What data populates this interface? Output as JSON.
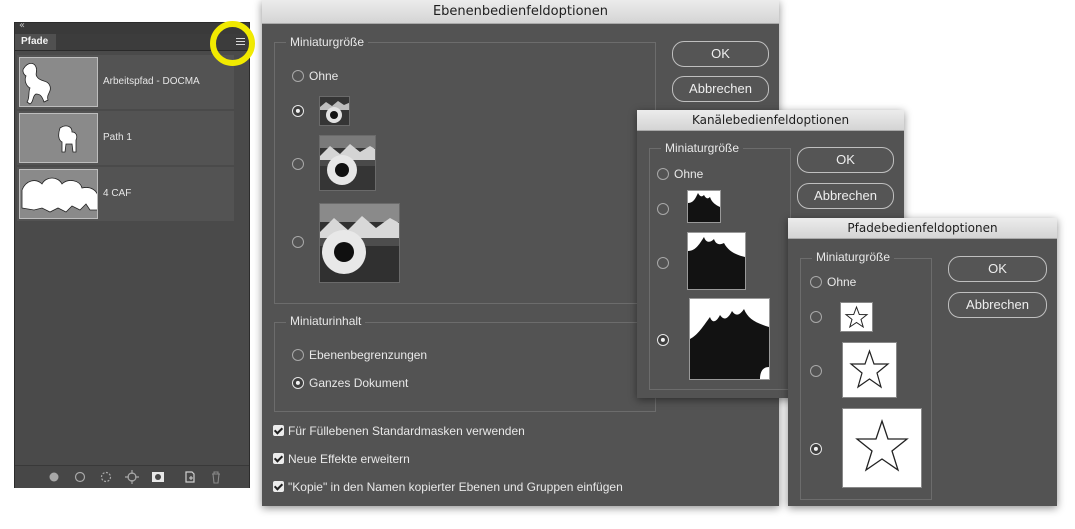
{
  "paths_panel": {
    "collapse_glyph": "‹‹",
    "tab_label": "Pfade",
    "menu_icon": "hamburger-menu-icon",
    "highlight_color": "#f1ea00",
    "rows": [
      {
        "label": "Arbeitspfad - DOCMA"
      },
      {
        "label": "Path 1"
      },
      {
        "label": "4 CAF"
      }
    ],
    "footer_icons": [
      "fill-path-icon",
      "stroke-path-icon",
      "load-as-selection-icon",
      "make-work-path-icon",
      "add-mask-icon",
      "new-path-icon",
      "delete-path-icon"
    ]
  },
  "layers_dialog": {
    "title": "Ebenenbedienfeldoptionen",
    "thumb_size_legend": "Miniaturgröße",
    "option_none": "Ohne",
    "thumb_content_legend": "Miniaturinhalt",
    "content_options": [
      "Ebenenbegrenzungen",
      "Ganzes Dokument"
    ],
    "checkboxes": [
      "Für Füllebenen Standardmasken verwenden",
      "Neue Effekte erweitern",
      "\"Kopie\" in den Namen kopierter Ebenen und Gruppen einfügen"
    ],
    "ok_label": "OK",
    "cancel_label": "Abbrechen"
  },
  "channels_dialog": {
    "title": "Kanälebedienfeldoptionen",
    "thumb_size_legend": "Miniaturgröße",
    "option_none": "Ohne",
    "ok_label": "OK",
    "cancel_label": "Abbrechen"
  },
  "paths_dialog": {
    "title": "Pfadebedienfeldoptionen",
    "thumb_size_legend": "Miniaturgröße",
    "option_none": "Ohne",
    "ok_label": "OK",
    "cancel_label": "Abbrechen"
  }
}
